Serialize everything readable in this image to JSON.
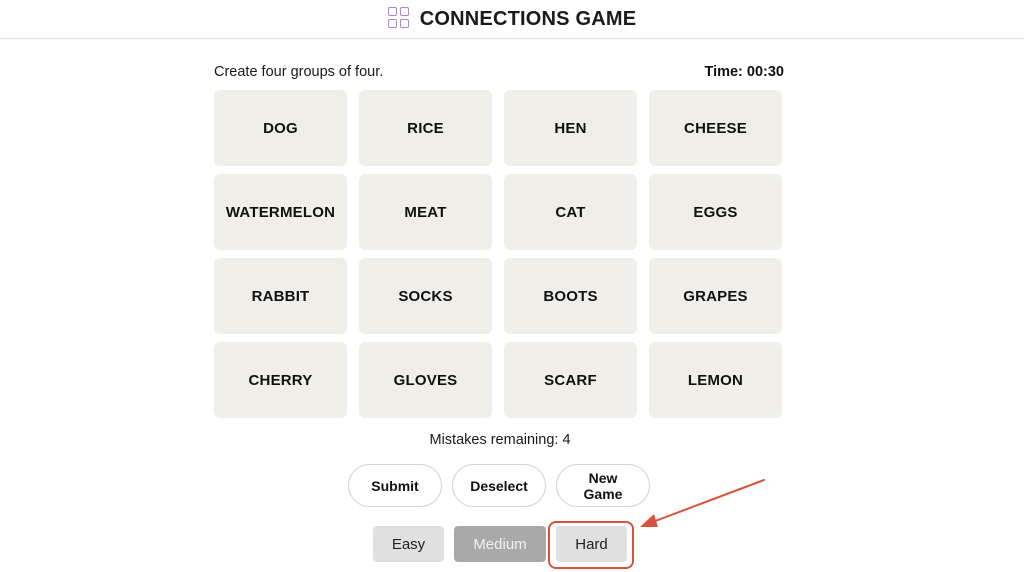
{
  "header": {
    "logo_icon": "grid-icon",
    "title": "CONNECTIONS GAME"
  },
  "game": {
    "instructions": "Create four groups of four.",
    "timer": "Time: 00:30",
    "tiles": [
      "DOG",
      "RICE",
      "HEN",
      "CHEESE",
      "WATERMELON",
      "MEAT",
      "CAT",
      "EGGS",
      "RABBIT",
      "SOCKS",
      "BOOTS",
      "GRAPES",
      "CHERRY",
      "GLOVES",
      "SCARF",
      "LEMON"
    ],
    "mistakes": "Mistakes remaining: 4"
  },
  "actions": {
    "submit": "Submit",
    "deselect": "Deselect",
    "new_game": "New\nGame"
  },
  "difficulty": {
    "options": [
      "Easy",
      "Medium",
      "Hard"
    ],
    "selected": "Medium"
  },
  "annotation": {
    "color": "#d9533a",
    "target": "Hard"
  },
  "colors": {
    "tile_bg": "#efeee9",
    "logo": "#b47fcf",
    "selected_difficulty_bg": "#a9a9a9"
  }
}
